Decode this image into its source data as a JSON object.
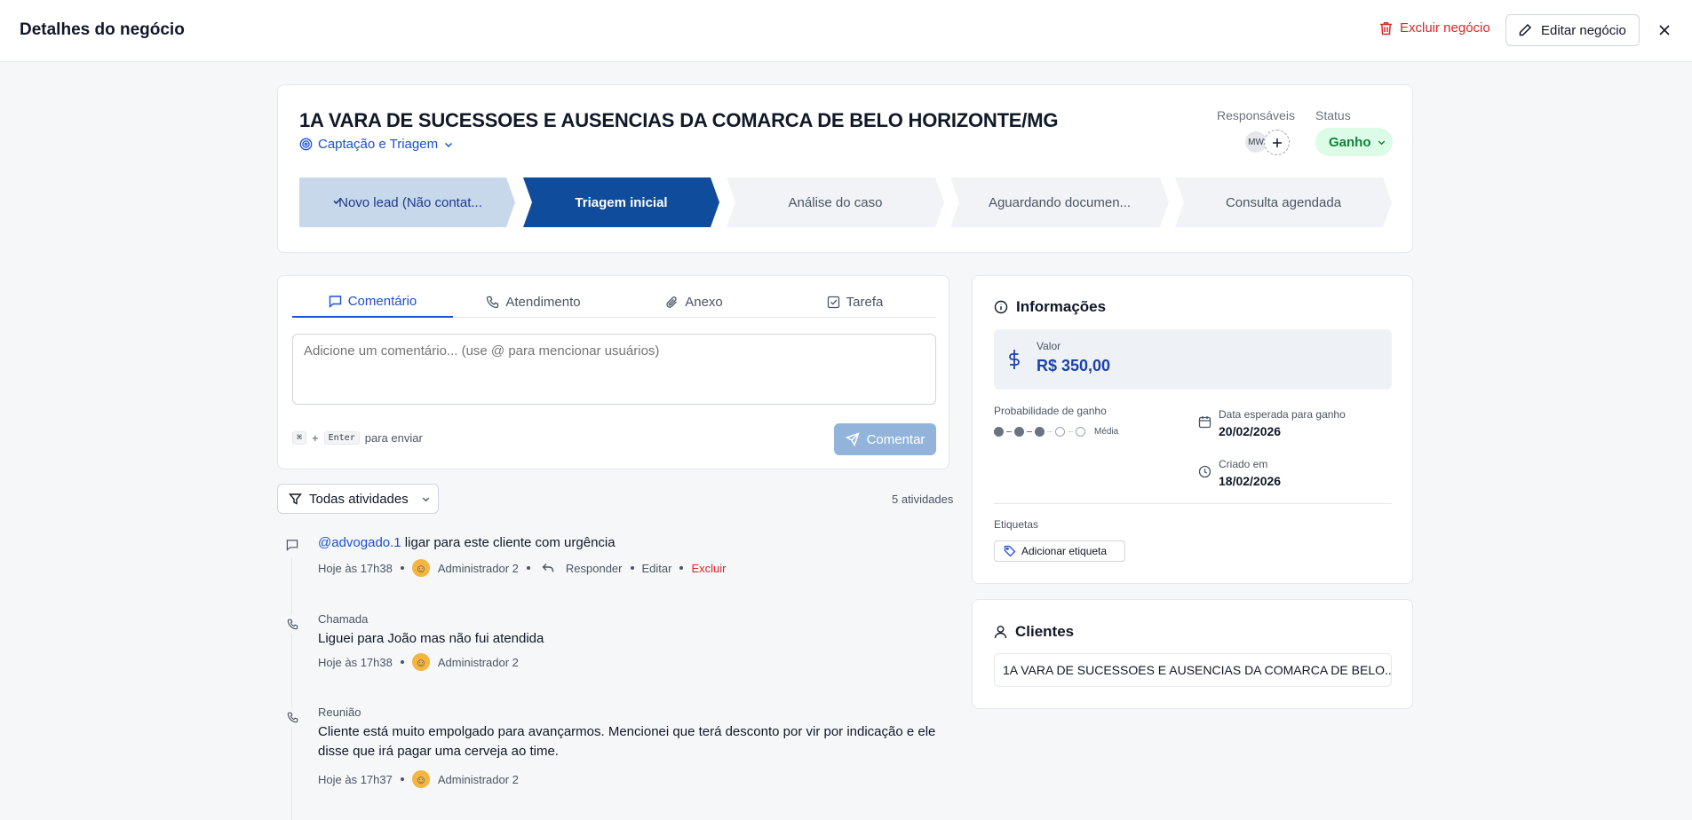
{
  "header": {
    "title": "Detalhes do negócio",
    "delete_label": "Excluir negócio",
    "edit_label": "Editar negócio"
  },
  "deal": {
    "title": "1A VARA DE SUCESSOES E AUSENCIAS DA COMARCA DE BELO HORIZONTE/MG",
    "pipeline": "Captação e Triagem",
    "responsibles_label": "Responsáveis",
    "responsible_initials": "MW",
    "status_label": "Status",
    "status_value": "Ganho",
    "stages": [
      {
        "label": "Novo lead (Não contat...",
        "state": "done"
      },
      {
        "label": "Triagem inicial",
        "state": "current"
      },
      {
        "label": "Análise do caso",
        "state": "pending"
      },
      {
        "label": "Aguardando documen...",
        "state": "pending"
      },
      {
        "label": "Consulta agendada",
        "state": "pending"
      }
    ]
  },
  "composer": {
    "tabs": [
      "Comentário",
      "Atendimento",
      "Anexo",
      "Tarefa"
    ],
    "active_tab": "Comentário",
    "placeholder": "Adicione um comentário... (use @ para mencionar usuários)",
    "hint_key1": "⌘",
    "hint_plus": "+",
    "hint_key2": "Enter",
    "hint_text": "para enviar",
    "submit_label": "Comentar"
  },
  "activities": {
    "filter_label": "Todas atividades",
    "count_label": "5 atividades",
    "items": [
      {
        "type": "",
        "mention": "@advogado.1",
        "text": " ligar para este cliente com urgência",
        "time": "Hoje às 17h38",
        "author": "Administrador 2",
        "actions": [
          "Responder",
          "Editar",
          "Excluir"
        ]
      },
      {
        "type": "Chamada",
        "text": "Liguei para João mas não fui atendida",
        "time": "Hoje às 17h38",
        "author": "Administrador 2"
      },
      {
        "type": "Reunião",
        "text": "Cliente está muito empolgado para avançarmos. Mencionei que terá desconto por vir por indicação e ele disse que irá pagar uma cerveja ao time.",
        "time": "Hoje às 17h37",
        "author": "Administrador 2"
      }
    ]
  },
  "info": {
    "title": "Informações",
    "value_label": "Valor",
    "value": "R$ 350,00",
    "probability_label": "Probabilidade de ganho",
    "probability_level": 3,
    "probability_max": 5,
    "probability_text": "Média",
    "expected_date_label": "Data esperada para ganho",
    "expected_date": "20/02/2026",
    "created_label": "Criado em",
    "created_date": "18/02/2026",
    "tags_label": "Etiquetas",
    "add_tag_label": "Adicionar etiqueta"
  },
  "clients": {
    "title": "Clientes",
    "items": [
      "1A VARA DE SUCESSOES E AUSENCIAS DA COMARCA DE BELO..."
    ]
  },
  "colors": {
    "primary": "#1d4ed8",
    "stage_current": "#0f4c9c",
    "stage_done": "#c8d8eb",
    "stage_pending": "#f1f3f6",
    "danger": "#dc2626",
    "success_bg": "#dcfce7",
    "success_text": "#15803d"
  }
}
